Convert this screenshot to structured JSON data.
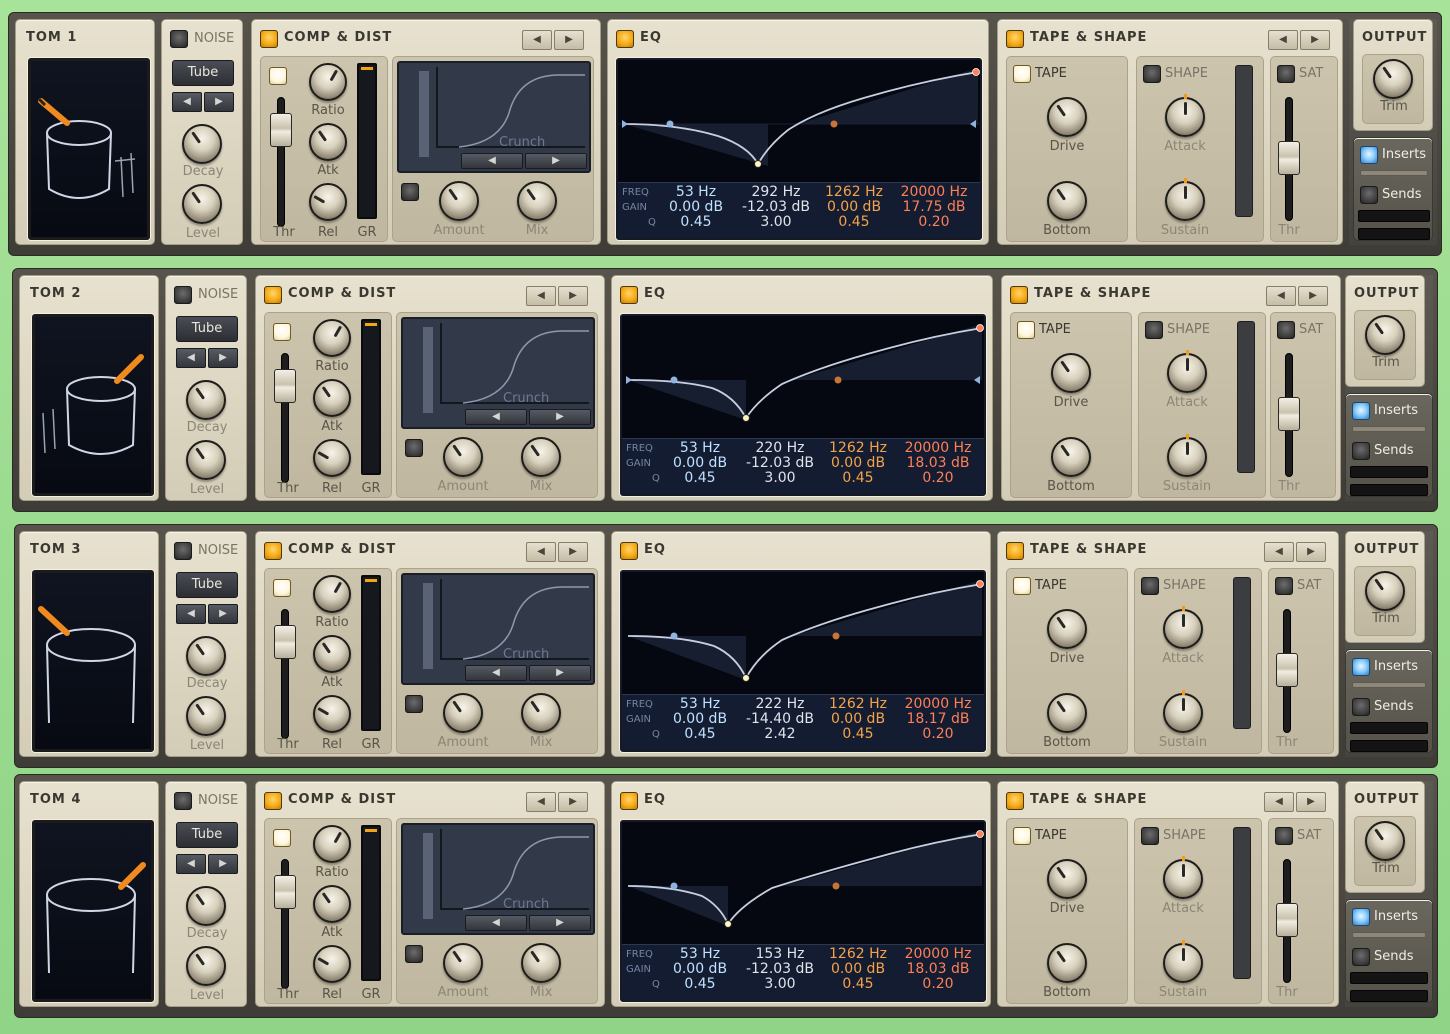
{
  "labels": {
    "noise": "NOISE",
    "tube": "Tube",
    "decay": "Decay",
    "level": "Level",
    "comp_dist": "COMP & DIST",
    "ratio": "Ratio",
    "atk": "Atk",
    "rel": "Rel",
    "thr": "Thr",
    "gr": "GR",
    "crunch": "Crunch",
    "amount": "Amount",
    "mix": "Mix",
    "eq": "EQ",
    "freq": "FREQ",
    "gain": "GAIN",
    "q": "Q",
    "tape_shape": "TAPE & SHAPE",
    "tape": "TAPE",
    "drive": "Drive",
    "bottom": "Bottom",
    "shape": "SHAPE",
    "attack": "Attack",
    "sustain": "Sustain",
    "sat": "SAT",
    "output": "OUTPUT",
    "trim": "Trim",
    "inserts": "Inserts",
    "sends": "Sends",
    "arrow_left": "◀",
    "arrow_right": "▶"
  },
  "colors": {
    "accent_orange": "#f5a712",
    "eq_blue": "#bfe0ff",
    "eq_orange": "#f5a24a",
    "eq_red": "#ff7f57",
    "background_green": "#a8e39a"
  },
  "strips": [
    {
      "name": "TOM 1",
      "eq": {
        "band1": {
          "freq": "53 Hz",
          "gain": "0.00 dB",
          "q": "0.45"
        },
        "band2": {
          "freq": "292 Hz",
          "gain": "-12.03 dB",
          "q": "3.00"
        },
        "band3": {
          "freq": "1262 Hz",
          "gain": "0.00 dB",
          "q": "0.45"
        },
        "band4": {
          "freq": "20000 Hz",
          "gain": "17.75 dB",
          "q": "0.20"
        }
      }
    },
    {
      "name": "TOM 2",
      "eq": {
        "band1": {
          "freq": "53 Hz",
          "gain": "0.00 dB",
          "q": "0.45"
        },
        "band2": {
          "freq": "220 Hz",
          "gain": "-12.03 dB",
          "q": "3.00"
        },
        "band3": {
          "freq": "1262 Hz",
          "gain": "0.00 dB",
          "q": "0.45"
        },
        "band4": {
          "freq": "20000 Hz",
          "gain": "18.03 dB",
          "q": "0.20"
        }
      }
    },
    {
      "name": "TOM 3",
      "eq": {
        "band1": {
          "freq": "53 Hz",
          "gain": "0.00 dB",
          "q": "0.45"
        },
        "band2": {
          "freq": "222 Hz",
          "gain": "-14.40 dB",
          "q": "2.42"
        },
        "band3": {
          "freq": "1262 Hz",
          "gain": "0.00 dB",
          "q": "0.45"
        },
        "band4": {
          "freq": "20000 Hz",
          "gain": "18.17 dB",
          "q": "0.20"
        }
      }
    },
    {
      "name": "TOM 4",
      "eq": {
        "band1": {
          "freq": "53 Hz",
          "gain": "0.00 dB",
          "q": "0.45"
        },
        "band2": {
          "freq": "153 Hz",
          "gain": "-12.03 dB",
          "q": "3.00"
        },
        "band3": {
          "freq": "1262 Hz",
          "gain": "0.00 dB",
          "q": "0.45"
        },
        "band4": {
          "freq": "20000 Hz",
          "gain": "18.03 dB",
          "q": "0.20"
        }
      }
    }
  ]
}
